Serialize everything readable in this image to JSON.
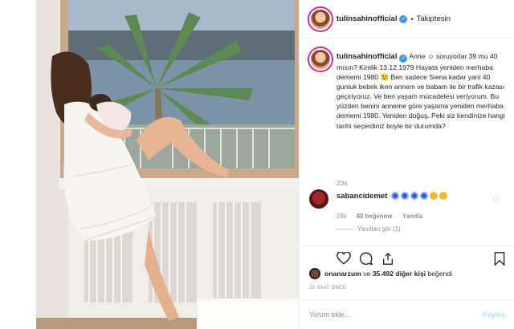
{
  "post": {
    "username": "tulinsahinofficial",
    "follow_status": "Takiptesin",
    "caption_text": "Anne ☺ soruyorlar 39 mu 40 mısın? Kimlik 13.12.1979 Hayata yeniden merhaba dememi 1980 😉 Ben sadece Siena kadar yani 40 gunluk bebek iken annem ve babam ile bir trafik kazası geçiriyoruz. Ve ben yaşam mücadelesi veriyorum. Bu yüzden benim anneme göre yaşama yeniden merhaba dememi 1980. Yeniden doğuş. Peki siz kendinize hangi tarihi seçerdiniz boyle bir durumda?",
    "caption_time": "23s"
  },
  "comment": {
    "username": "sabancidemet",
    "time": "23s",
    "likes": "40 beğenme",
    "reply": "Yanıtla",
    "view_replies": "Yanıtları gör (1)"
  },
  "likes": {
    "user": "onanarzum",
    "connector": "ve",
    "others": "35.492 diğer kişi",
    "suffix": "beğendi"
  },
  "time_ago": "23 SAAT ÖNCE",
  "comment_box": {
    "placeholder": "Yorum ekle...",
    "submit_label": "Paylaş"
  },
  "icons": {
    "like": "heart-icon",
    "comment": "comment-icon",
    "share": "share-icon",
    "save": "bookmark-icon",
    "verified": "verified-badge-icon"
  },
  "colors": {
    "verified": "#3897f0",
    "muted": "#8e8e8e",
    "submit_disabled": "#b2dffc"
  }
}
